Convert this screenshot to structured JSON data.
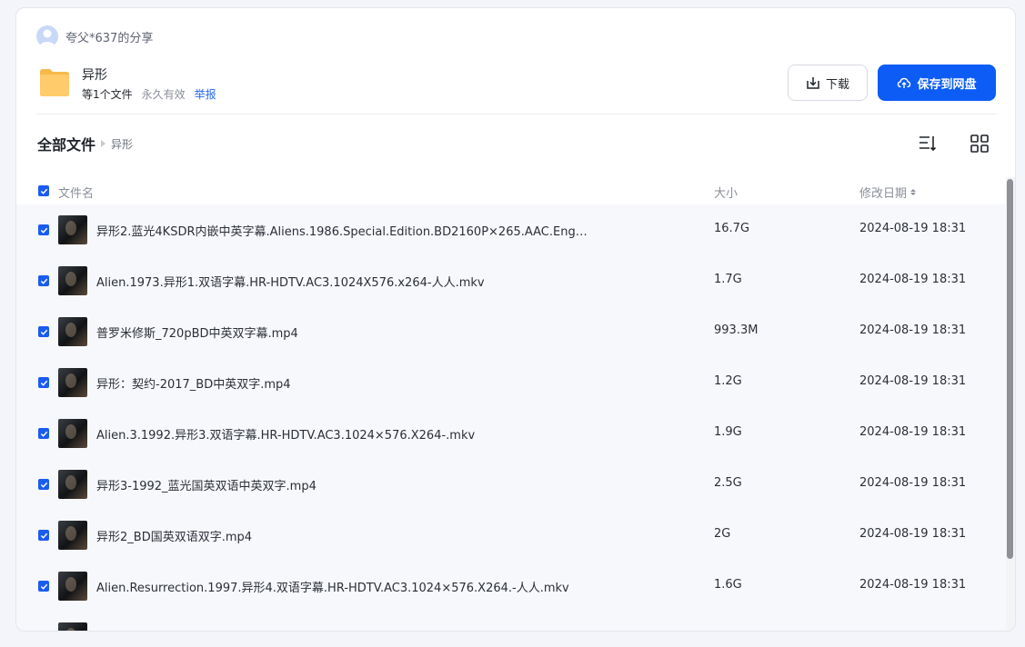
{
  "sharer": {
    "text": "夸父*637的分享"
  },
  "share": {
    "title": "异形",
    "count_text": "等1个文件",
    "validity_text": "永久有效",
    "report_label": "举报"
  },
  "actions": {
    "download_label": "下载",
    "save_label": "保存到网盘"
  },
  "breadcrumb": {
    "root": "全部文件",
    "current": "异形"
  },
  "table": {
    "headers": {
      "name": "文件名",
      "size": "大小",
      "date": "修改日期"
    },
    "rows": [
      {
        "name": "异形2.蓝光4KSDR内嵌中英字幕.Aliens.1986.Special.Edition.BD2160P×265.AAC.Englis...",
        "size": "16.7G",
        "date": "2024-08-19 18:31"
      },
      {
        "name": "Alien.1973.异形1.双语字幕.HR-HDTV.AC3.1024X576.x264-人人.mkv",
        "size": "1.7G",
        "date": "2024-08-19 18:31"
      },
      {
        "name": "普罗米修斯_720pBD中英双字幕.mp4",
        "size": "993.3M",
        "date": "2024-08-19 18:31"
      },
      {
        "name": "异形：契约-2017_BD中英双字.mp4",
        "size": "1.2G",
        "date": "2024-08-19 18:31"
      },
      {
        "name": "Alien.3.1992.异形3.双语字幕.HR-HDTV.AC3.1024×576.X264-.mkv",
        "size": "1.9G",
        "date": "2024-08-19 18:31"
      },
      {
        "name": "异形3-1992_蓝光国英双语中英双字.mp4",
        "size": "2.5G",
        "date": "2024-08-19 18:31"
      },
      {
        "name": "异形2_BD国英双语双字.mp4",
        "size": "2G",
        "date": "2024-08-19 18:31"
      },
      {
        "name": "Alien.Resurrection.1997.异形4.双语字幕.HR-HDTV.AC3.1024×576.X264.-人人.mkv",
        "size": "1.6G",
        "date": "2024-08-19 18:31"
      },
      {
        "name": "",
        "size": "",
        "date": ""
      }
    ]
  },
  "colors": {
    "primary": "#0d5cf6",
    "link": "#2468f2",
    "folder": "#ffc35a"
  }
}
